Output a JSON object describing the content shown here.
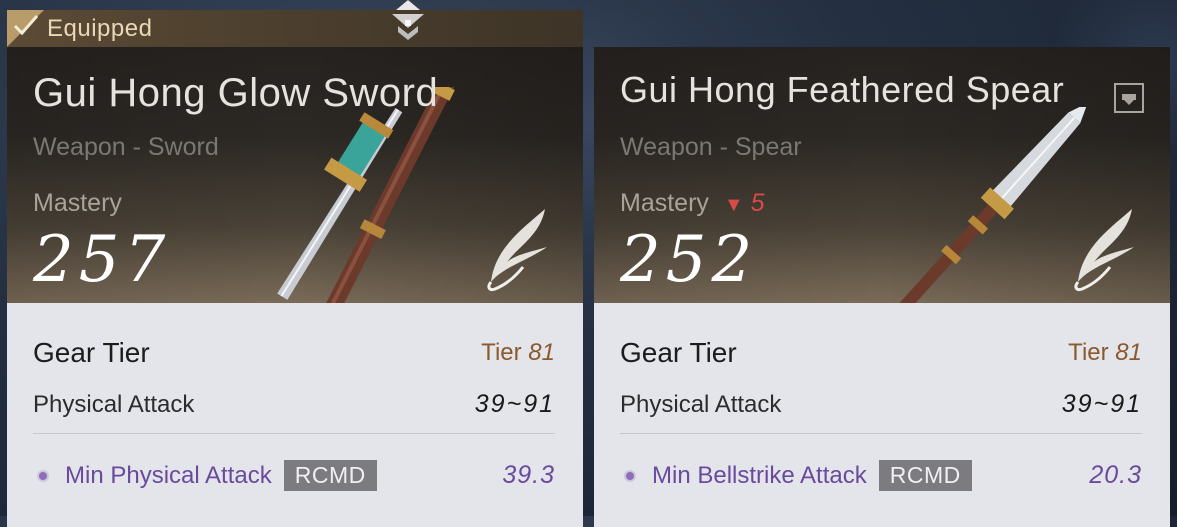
{
  "equipped_label": "Equipped",
  "cards": [
    {
      "name": "Gui Hong Glow Sword",
      "type": "Weapon - Sword",
      "mastery_label": "Mastery",
      "mastery_value": "257",
      "gear_tier_label": "Gear Tier",
      "tier_prefix": "Tier",
      "tier_value": "81",
      "attack_label": "Physical Attack",
      "attack_value": "39~91",
      "substat_label": "Min Physical Attack",
      "substat_badge": "RCMD",
      "substat_value": "39.3"
    },
    {
      "name": "Gui Hong Feathered Spear",
      "type": "Weapon - Spear",
      "mastery_label": "Mastery",
      "mastery_diff": "5",
      "mastery_value": "252",
      "gear_tier_label": "Gear Tier",
      "tier_prefix": "Tier",
      "tier_value": "81",
      "attack_label": "Physical Attack",
      "attack_value": "39~91",
      "substat_label": "Min Bellstrike Attack",
      "substat_badge": "RCMD",
      "substat_value": "20.3"
    }
  ],
  "colors": {
    "tier": "#8a5a2e",
    "substat": "#6a4a9c",
    "mastery_down": "#d84a48",
    "panel_bg": "#e3e5ea"
  },
  "icons": [
    "check-icon",
    "compare-icon",
    "lock-icon",
    "wing-icon",
    "bullet-icon",
    "mastery-down-icon"
  ]
}
